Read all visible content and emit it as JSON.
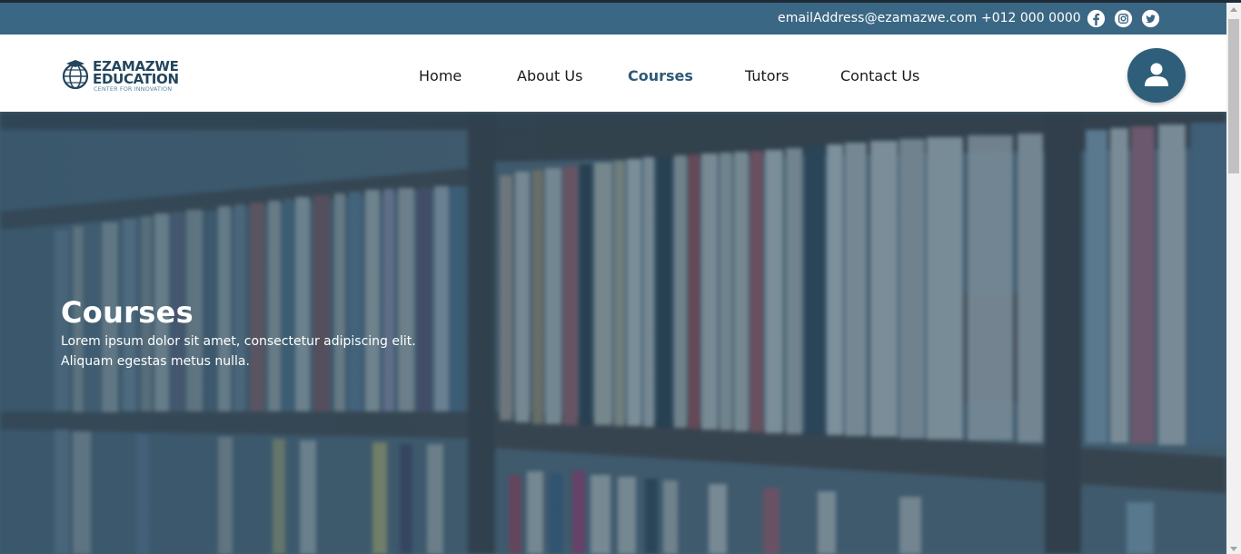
{
  "topbar": {
    "email": "emailAddress@ezamazwe.com",
    "phone": "+012 000 0000",
    "social": [
      {
        "icon": "facebook-icon"
      },
      {
        "icon": "instagram-icon"
      },
      {
        "icon": "twitter-icon"
      }
    ]
  },
  "logo": {
    "line1": "EZAMAZWE",
    "line2": "EDUCATION",
    "tagline": "CENTER FOR INNOVATION"
  },
  "nav": {
    "items": [
      {
        "label": "Home",
        "active": false
      },
      {
        "label": "About Us",
        "active": false
      },
      {
        "label": "Courses",
        "active": true
      },
      {
        "label": "Tutors",
        "active": false
      },
      {
        "label": "Contact Us",
        "active": false
      }
    ]
  },
  "account": {
    "icon": "user-icon"
  },
  "hero": {
    "title": "Courses",
    "text": "Lorem ipsum dolor sit amet, consectetur adipiscing elit. Aliquam egestas metus nulla.",
    "background": "bookshelf-image"
  },
  "colors": {
    "topbar": "#3a6784",
    "accent": "#2f5a77",
    "avatar": "#2e5e7a"
  }
}
